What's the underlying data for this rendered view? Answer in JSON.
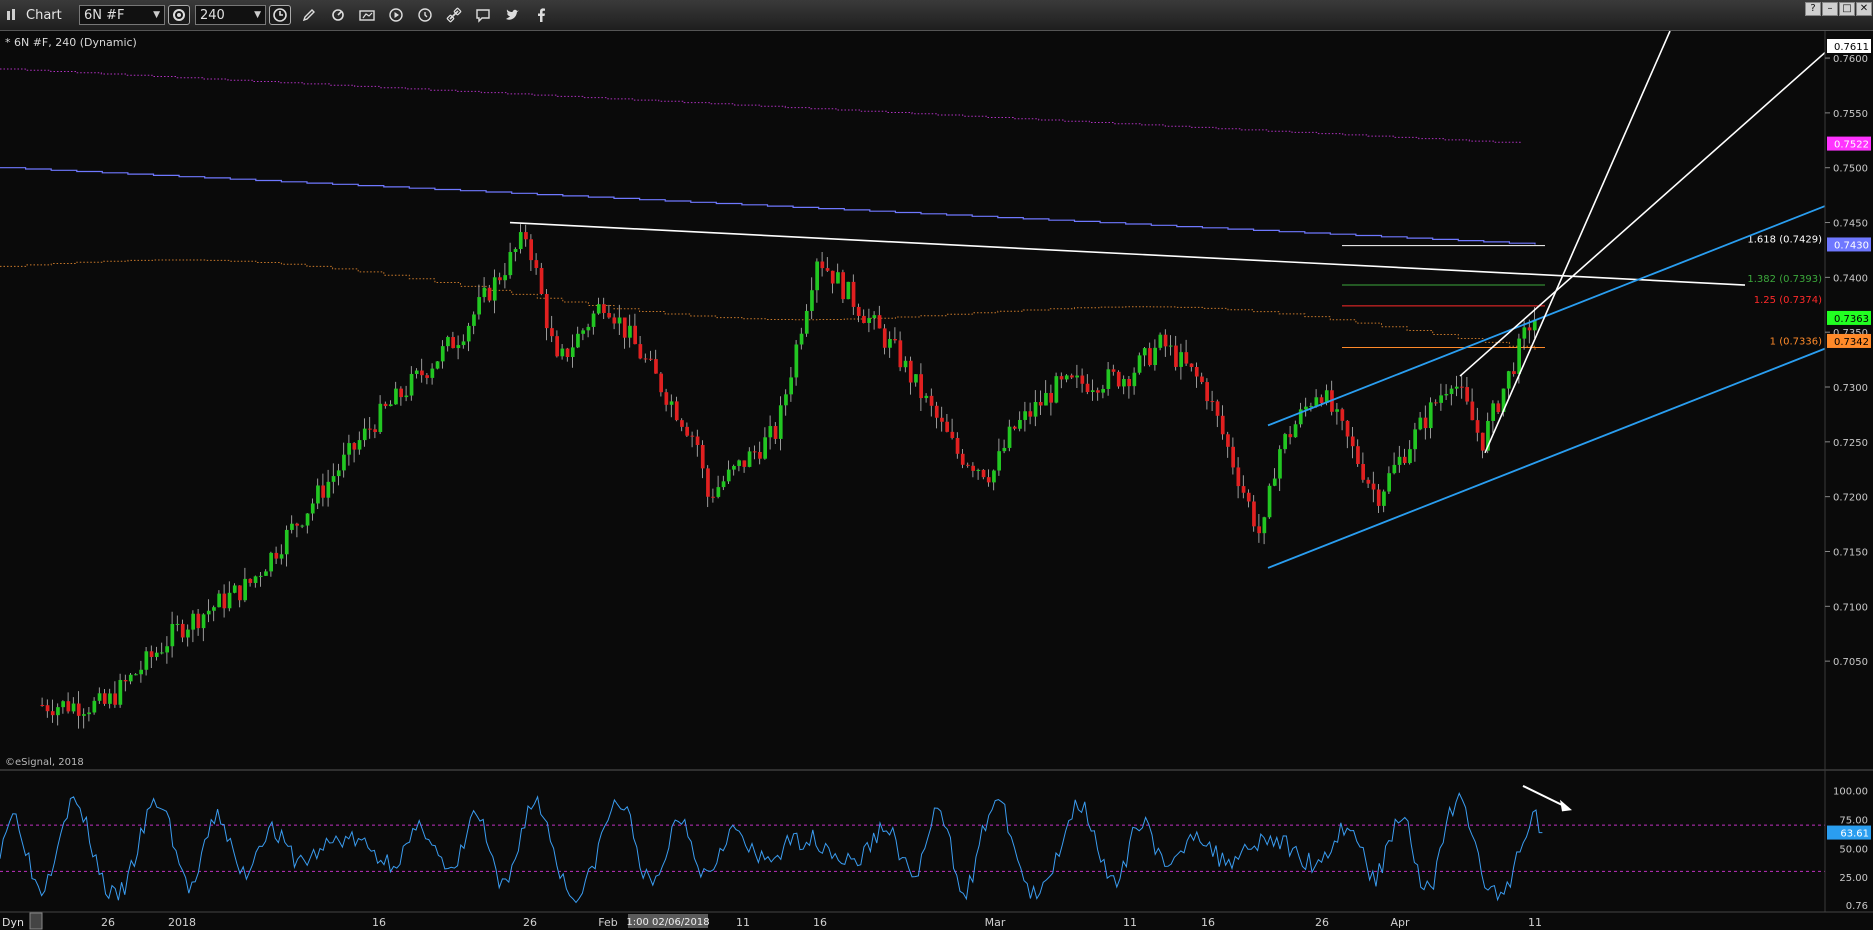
{
  "toolbar": {
    "app_title": "Chart",
    "symbol_value": "6N #F",
    "interval_value": "240",
    "window_buttons": [
      "?",
      "–",
      "□",
      "✕"
    ]
  },
  "chart_data": [
    {
      "type": "candlestick",
      "title": "* 6N #F, 240 (Dynamic)",
      "watermark": "©eSignal, 2018",
      "ylim": [
        0.701,
        0.7611
      ],
      "yticks": [
        "0.7600",
        "0.7550",
        "0.7500",
        "0.7450",
        "0.7400",
        "0.7350",
        "0.7300",
        "0.7250",
        "0.7200",
        "0.7150",
        "0.7100",
        "0.7050"
      ],
      "ytick_values": [
        0.76,
        0.755,
        0.75,
        0.745,
        0.74,
        0.735,
        0.73,
        0.725,
        0.72,
        0.715,
        0.71,
        0.705
      ],
      "xtick_labels": [
        "26",
        "2018",
        "16",
        "26",
        "Feb",
        "11",
        "16",
        "Mar",
        "11",
        "16",
        "26",
        "Apr",
        "11"
      ],
      "cursor_label": "1:00 02/06/2018",
      "price_tags": [
        {
          "text": "0.7611",
          "value": 0.7611,
          "bg": "#ffffff",
          "fg": "#000000"
        },
        {
          "text": "0.7522",
          "value": 0.7522,
          "bg": "#ff33ff",
          "fg": "#ffffff"
        },
        {
          "text": "0.7430",
          "value": 0.743,
          "bg": "#6f78ff",
          "fg": "#ffffff"
        },
        {
          "text": "0.7363",
          "value": 0.7363,
          "bg": "#22ff22",
          "fg": "#000000"
        },
        {
          "text": "0.7342",
          "value": 0.7342,
          "bg": "#ff8a2a",
          "fg": "#000000"
        }
      ],
      "fib_levels": [
        {
          "label": "1.618 (0.7429)",
          "value": 0.7429,
          "color": "#ffffff"
        },
        {
          "label": "1.382 (0.7393)",
          "value": 0.7393,
          "color": "#3ca83c"
        },
        {
          "label": "1.25 (0.7374)",
          "value": 0.7374,
          "color": "#ff2a2a"
        },
        {
          "label": "1 (0.7336)",
          "value": 0.7336,
          "color": "#ff8a2a"
        }
      ],
      "path_keypoints": [
        [
          "26",
          0.701
        ],
        [
          "2018",
          0.708
        ],
        [
          "9 Jan",
          0.712
        ],
        [
          "16",
          0.727
        ],
        [
          "22",
          0.735
        ],
        [
          "26",
          0.744
        ],
        [
          "29",
          0.732
        ],
        [
          "Feb",
          0.738
        ],
        [
          "6 Feb",
          0.725
        ],
        [
          "9 Feb",
          0.72
        ],
        [
          "13 Feb",
          0.726
        ],
        [
          "16",
          0.742
        ],
        [
          "21 Feb",
          0.733
        ],
        [
          "27 Feb",
          0.724
        ],
        [
          "Mar",
          0.722
        ],
        [
          "5 Mar",
          0.726
        ],
        [
          "7 Mar",
          0.73
        ],
        [
          "11",
          0.731
        ],
        [
          "13 Mar",
          0.734
        ],
        [
          "16",
          0.73
        ],
        [
          "21 Mar",
          0.716
        ],
        [
          "23 Mar",
          0.724
        ],
        [
          "26",
          0.73
        ],
        [
          "29 Mar",
          0.72
        ],
        [
          "Apr",
          0.723
        ],
        [
          "5 Apr",
          0.731
        ],
        [
          "8 Apr",
          0.725
        ],
        [
          "11",
          0.7363
        ]
      ],
      "moving_averages": [
        {
          "name": "purple dotted",
          "color": "#b030c0",
          "style": "dotted",
          "start": 0.759,
          "end": 0.7522
        },
        {
          "name": "blue",
          "color": "#6f78ff",
          "style": "solid",
          "start": 0.75,
          "end": 0.743
        },
        {
          "name": "orange dotted",
          "color": "#c8782a",
          "style": "dotted",
          "start": 0.741,
          "end": 0.7342
        }
      ],
      "trend_lines": [
        {
          "name": "resistance",
          "color": "#ffffff",
          "from": [
            "26",
            0.745
          ],
          "to": [
            "11",
            0.7392
          ]
        },
        {
          "name": "channel lower",
          "color": "#2a9ef0",
          "from": [
            "23 Mar",
            0.7135
          ],
          "to": [
            "11",
            0.733
          ]
        },
        {
          "name": "channel upper",
          "color": "#2a9ef0",
          "from": [
            "23 Mar",
            0.7265
          ],
          "to": [
            "11",
            0.746
          ]
        },
        {
          "name": "fan steep",
          "color": "#ffffff",
          "from": [
            "8 Apr",
            0.724
          ],
          "to": [
            "11",
            0.7611
          ]
        },
        {
          "name": "fan shallow",
          "color": "#ffffff",
          "from": [
            "8 Apr",
            0.724
          ],
          "to": [
            "11",
            0.7611
          ]
        }
      ],
      "oscillator": {
        "label": "Dyn",
        "ylim": [
          0,
          110
        ],
        "yticks": [
          "100.00",
          "75.00",
          "50.00",
          "25.00",
          "0.76"
        ],
        "ytick_values": [
          100,
          75,
          50,
          25,
          0.76
        ],
        "levels": [
          70,
          30
        ],
        "current_text": "63.61",
        "current_value": 63.61
      }
    }
  ]
}
